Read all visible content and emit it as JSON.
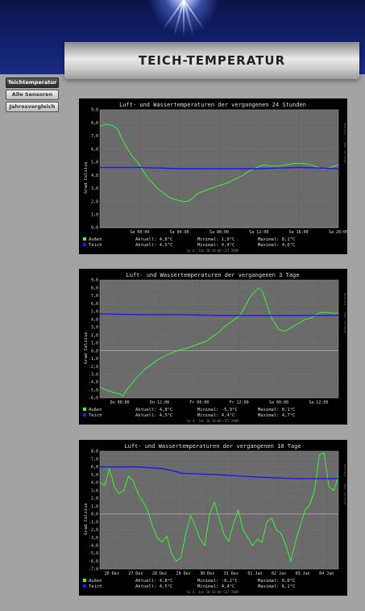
{
  "header": {
    "title": "TEICH-TEMPERATUR"
  },
  "nav": {
    "items": [
      "Teichtemperatur",
      "Alle Sensoren",
      "Jahresvergleich"
    ]
  },
  "colors": {
    "air": "#33ff33",
    "water": "#1818ff",
    "plot_bg": "#6b6b6b",
    "zero_line": "#b0b0b0"
  },
  "charts": [
    {
      "title": "Luft- und Wassertemperaturen der vergangenen 24 Stunden",
      "ylabel": "Grad Celsius",
      "side_text": "RRDTOOL / TOBI OETIKER",
      "footer": "So 4. Jan 20:18:06 CET 2009",
      "legend": [
        {
          "name": "Außen",
          "aktuell": "Aktuell:  4,8°C",
          "minimal": "Minimal:  1,9°C",
          "maximal": "Maximal:  8,1°C"
        },
        {
          "name": "Teich",
          "aktuell": "Aktuell:  4,5°C",
          "minimal": "Minimal:  4,4°C",
          "maximal": "Maximal:  4,6°C"
        }
      ]
    },
    {
      "title": "Luft- und Wassertemperaturen der vergangenen 3 Tage",
      "ylabel": "Grad Celsius",
      "side_text": "RRDTOOL / TOBI OETIKER",
      "footer": "So 4. Jan 20:18:06 CET 2009",
      "legend": [
        {
          "name": "Außen",
          "aktuell": "Aktuell:  4,8°C",
          "minimal": "Minimal: -5,9°C",
          "maximal": "Maximal:  8,1°C"
        },
        {
          "name": "Teich",
          "aktuell": "Aktuell:  4,5°C",
          "minimal": "Minimal:  4,4°C",
          "maximal": "Maximal:  4,7°C"
        }
      ]
    },
    {
      "title": "Luft- und Wassertemperaturen der vergangenen 10 Tage",
      "ylabel": "Grad Celsius",
      "side_text": "RRDTOOL / TOBI OETIKER",
      "footer": "So 4. Jan 20:18:06 CET 2009",
      "legend": [
        {
          "name": "Außen",
          "aktuell": "Aktuell:  4,8°C",
          "minimal": "Minimal: -6,2°C",
          "maximal": "Maximal:  8,0°C"
        },
        {
          "name": "Teich",
          "aktuell": "Aktuell:  4,5°C",
          "minimal": "Minimal:  4,4°C",
          "maximal": "Maximal:  6,1°C"
        }
      ]
    }
  ],
  "chart_data": [
    {
      "type": "line",
      "ylim": [
        0,
        9
      ],
      "yticks": [
        "0,0",
        "1,0",
        "2,0",
        "3,0",
        "4,0",
        "5,0",
        "6,0",
        "7,0",
        "8,0",
        "9,0"
      ],
      "xlim": [
        0,
        24
      ],
      "xticks": [
        {
          "x": 4,
          "label": "Sa 00:00"
        },
        {
          "x": 8,
          "label": "Sa 04:00"
        },
        {
          "x": 12,
          "label": "Sa 08:00"
        },
        {
          "x": 16,
          "label": "Sa 12:00"
        },
        {
          "x": 20,
          "label": "Sa 16:00"
        },
        {
          "x": 24,
          "label": "Sa 20:00"
        }
      ],
      "series": [
        {
          "name": "Außen",
          "x": [
            0,
            0.6,
            1.3,
            1.8,
            2.2,
            2.8,
            3.2,
            3.8,
            4.3,
            4.8,
            5.3,
            5.8,
            6.3,
            6.8,
            7.3,
            7.8,
            8.3,
            8.8,
            9.3,
            9.8,
            10.5,
            11.2,
            12,
            12.8,
            13.6,
            14.4,
            15,
            15.8,
            16.5,
            17.2,
            18,
            18.8,
            19.6,
            20.4,
            21.2,
            22,
            22.6,
            23.2,
            24
          ],
          "y": [
            7.7,
            7.9,
            7.8,
            7.5,
            6.8,
            6.0,
            5.5,
            5.0,
            4.4,
            3.8,
            3.4,
            3.0,
            2.7,
            2.4,
            2.2,
            2.1,
            2.0,
            2.0,
            2.2,
            2.6,
            2.8,
            3.0,
            3.2,
            3.4,
            3.7,
            4.0,
            4.3,
            4.6,
            4.8,
            4.7,
            4.7,
            4.8,
            4.9,
            4.9,
            4.8,
            4.6,
            4.5,
            4.6,
            4.8
          ]
        },
        {
          "name": "Teich",
          "x": [
            0,
            4,
            8,
            12,
            16,
            20,
            24
          ],
          "y": [
            4.6,
            4.6,
            4.5,
            4.5,
            4.5,
            4.6,
            4.5
          ]
        }
      ]
    },
    {
      "type": "line",
      "ylim": [
        -6,
        9
      ],
      "yticks": [
        "-6,0",
        "-5,0",
        "-4,0",
        "-3,0",
        "-2,0",
        "-1,0",
        "0,0",
        "1,0",
        "2,0",
        "3,0",
        "4,0",
        "5,0",
        "6,0",
        "7,0",
        "8,0",
        "9,0"
      ],
      "xlim": [
        0,
        72
      ],
      "xticks": [
        {
          "x": 6,
          "label": "Do 00:00"
        },
        {
          "x": 18,
          "label": "Do 12:00"
        },
        {
          "x": 30,
          "label": "Fr 00:00"
        },
        {
          "x": 42,
          "label": "Fr 12:00"
        },
        {
          "x": 54,
          "label": "Sa 00:00"
        },
        {
          "x": 66,
          "label": "Sa 12:00"
        }
      ],
      "series": [
        {
          "name": "Außen",
          "x": [
            0,
            2,
            4,
            6,
            7,
            8,
            10,
            12,
            14,
            16,
            18,
            20,
            22,
            24,
            26,
            28,
            30,
            32,
            34,
            36,
            38,
            40,
            42,
            43,
            44,
            45,
            46,
            47,
            48,
            49,
            50,
            51,
            52,
            53,
            54,
            56,
            58,
            60,
            62,
            64,
            66,
            68,
            70,
            72
          ],
          "y": [
            -4.6,
            -5.0,
            -5.3,
            -5.5,
            -5.8,
            -5.0,
            -4.0,
            -3.0,
            -2.2,
            -1.6,
            -1.0,
            -0.6,
            -0.2,
            0.1,
            0.3,
            0.6,
            0.9,
            1.2,
            1.8,
            2.4,
            3.2,
            3.8,
            4.4,
            5.0,
            5.8,
            6.6,
            7.2,
            7.6,
            8.0,
            7.6,
            6.4,
            5.0,
            4.0,
            3.4,
            2.7,
            2.5,
            3.0,
            3.5,
            4.0,
            4.2,
            4.8,
            4.9,
            4.8,
            4.8
          ]
        },
        {
          "name": "Teich",
          "x": [
            0,
            12,
            24,
            36,
            48,
            60,
            72
          ],
          "y": [
            4.7,
            4.6,
            4.6,
            4.5,
            4.5,
            4.5,
            4.5
          ]
        }
      ]
    },
    {
      "type": "line",
      "ylim": [
        -7,
        8
      ],
      "yticks": [
        "-7,0",
        "-6,0",
        "-5,0",
        "-4,0",
        "-3,0",
        "-2,0",
        "-1,0",
        "0,0",
        "1,0",
        "2,0",
        "3,0",
        "4,0",
        "5,0",
        "6,0",
        "7,0",
        "8,0"
      ],
      "xlim": [
        0,
        10
      ],
      "xticks": [
        {
          "x": 0.5,
          "label": "26 Dez"
        },
        {
          "x": 1.5,
          "label": "27 Dez"
        },
        {
          "x": 2.5,
          "label": "28 Dez"
        },
        {
          "x": 3.5,
          "label": "29 Dez"
        },
        {
          "x": 4.5,
          "label": "30 Dez"
        },
        {
          "x": 5.5,
          "label": "31 Dez"
        },
        {
          "x": 6.5,
          "label": "01 Jan"
        },
        {
          "x": 7.5,
          "label": "02 Jan"
        },
        {
          "x": 8.5,
          "label": "03 Jan"
        },
        {
          "x": 9.5,
          "label": "04 Jan"
        }
      ],
      "series": [
        {
          "name": "Außen",
          "x": [
            0,
            0.2,
            0.4,
            0.6,
            0.8,
            1.0,
            1.2,
            1.4,
            1.6,
            1.8,
            2.0,
            2.2,
            2.4,
            2.6,
            2.8,
            3.0,
            3.2,
            3.4,
            3.6,
            3.8,
            4.0,
            4.2,
            4.4,
            4.6,
            4.8,
            5.0,
            5.2,
            5.4,
            5.6,
            5.8,
            6.0,
            6.2,
            6.4,
            6.6,
            6.8,
            7.0,
            7.2,
            7.4,
            7.6,
            7.8,
            8.0,
            8.2,
            8.4,
            8.6,
            8.8,
            9.0,
            9.2,
            9.4,
            9.6,
            9.8,
            10.0
          ],
          "y": [
            4.0,
            3.6,
            5.8,
            3.5,
            2.6,
            3.0,
            4.8,
            4.2,
            2.6,
            1.6,
            0.5,
            -1.5,
            -3.0,
            -3.6,
            -2.8,
            -5.0,
            -6.0,
            -5.6,
            -2.5,
            -0.2,
            -1.5,
            -3.2,
            -4.0,
            0.0,
            1.5,
            -0.5,
            -2.5,
            -3.5,
            -1.2,
            0.5,
            -2.0,
            -3.0,
            -4.0,
            -3.2,
            -3.6,
            -1.0,
            -0.5,
            -2.0,
            -2.5,
            -4.0,
            -6.0,
            -3.5,
            -1.5,
            0.5,
            1.2,
            3.0,
            7.5,
            7.8,
            3.5,
            3.0,
            4.8
          ]
        },
        {
          "name": "Teich",
          "x": [
            0,
            1.6,
            2.6,
            3.2,
            3.4,
            5.0,
            6.6,
            8.2,
            9.2,
            10.0
          ],
          "y": [
            6.0,
            6.0,
            5.8,
            5.4,
            5.2,
            5.0,
            4.7,
            4.5,
            4.5,
            4.5
          ]
        }
      ]
    }
  ]
}
